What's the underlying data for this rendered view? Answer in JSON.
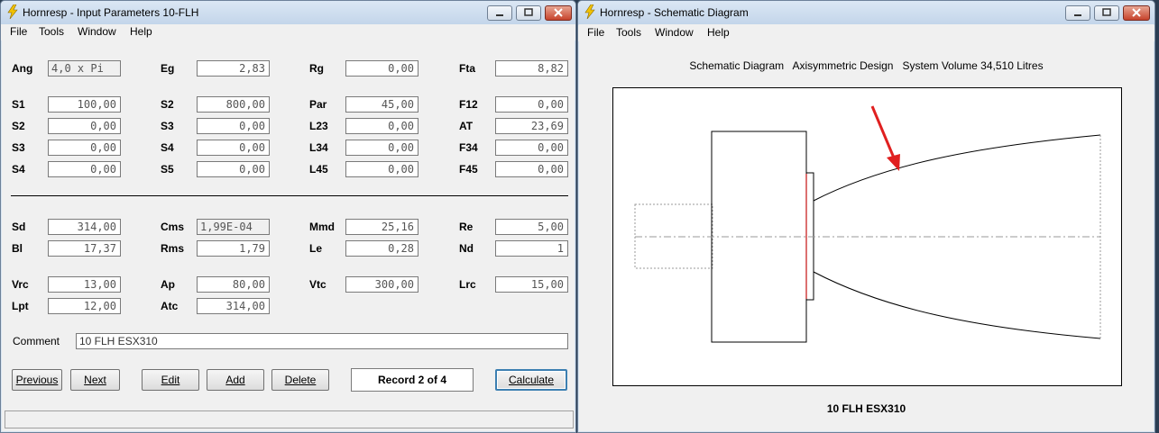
{
  "left_window": {
    "title": "Hornresp - Input Parameters   10-FLH",
    "menu": [
      "File",
      "Tools",
      "Window",
      "Help"
    ],
    "params": [
      {
        "id": "ang",
        "label": "Ang",
        "value": "4,0 x Pi",
        "ro": true,
        "left": true
      },
      {
        "id": "eg",
        "label": "Eg",
        "value": "2,83"
      },
      {
        "id": "rg",
        "label": "Rg",
        "value": "0,00"
      },
      {
        "id": "fta",
        "label": "Fta",
        "value": "8,82"
      },
      {
        "id": "s1",
        "label": "S1",
        "value": "100,00"
      },
      {
        "id": "s2a",
        "label": "S2",
        "value": "800,00"
      },
      {
        "id": "par",
        "label": "Par",
        "value": "45,00"
      },
      {
        "id": "f12",
        "label": "F12",
        "value": "0,00"
      },
      {
        "id": "s2b",
        "label": "S2",
        "value": "0,00"
      },
      {
        "id": "s3a",
        "label": "S3",
        "value": "0,00"
      },
      {
        "id": "l23",
        "label": "L23",
        "value": "0,00"
      },
      {
        "id": "at",
        "label": "AT",
        "value": "23,69"
      },
      {
        "id": "s3b",
        "label": "S3",
        "value": "0,00"
      },
      {
        "id": "s4a",
        "label": "S4",
        "value": "0,00"
      },
      {
        "id": "l34",
        "label": "L34",
        "value": "0,00"
      },
      {
        "id": "f34",
        "label": "F34",
        "value": "0,00"
      },
      {
        "id": "s4b",
        "label": "S4",
        "value": "0,00"
      },
      {
        "id": "s5",
        "label": "S5",
        "value": "0,00"
      },
      {
        "id": "l45",
        "label": "L45",
        "value": "0,00"
      },
      {
        "id": "f45",
        "label": "F45",
        "value": "0,00"
      },
      {
        "id": "sd",
        "label": "Sd",
        "value": "314,00"
      },
      {
        "id": "cms",
        "label": "Cms",
        "value": "1,99E-04",
        "ro": true,
        "left": true
      },
      {
        "id": "mmd",
        "label": "Mmd",
        "value": "25,16"
      },
      {
        "id": "re",
        "label": "Re",
        "value": "5,00"
      },
      {
        "id": "bl",
        "label": "Bl",
        "value": "17,37"
      },
      {
        "id": "rms",
        "label": "Rms",
        "value": "1,79"
      },
      {
        "id": "le",
        "label": "Le",
        "value": "0,28"
      },
      {
        "id": "nd",
        "label": "Nd",
        "value": "1"
      },
      {
        "id": "vrc",
        "label": "Vrc",
        "value": "13,00"
      },
      {
        "id": "ap",
        "label": "Ap",
        "value": "80,00"
      },
      {
        "id": "vtc",
        "label": "Vtc",
        "value": "300,00"
      },
      {
        "id": "lrc",
        "label": "Lrc",
        "value": "15,00"
      },
      {
        "id": "lpt",
        "label": "Lpt",
        "value": "12,00"
      },
      {
        "id": "atc",
        "label": "Atc",
        "value": "314,00"
      }
    ],
    "comment_label": "Comment",
    "comment_value": "10 FLH ESX310",
    "buttons": {
      "previous": "Previous",
      "next": "Next",
      "edit": "Edit",
      "add": "Add",
      "delete": "Delete",
      "calculate": "Calculate"
    },
    "record_text": "Record 2 of 4"
  },
  "right_window": {
    "title": "Hornresp - Schematic Diagram",
    "menu": [
      "File",
      "Tools",
      "Window",
      "Help"
    ],
    "header": "Schematic Diagram   Axisymmetric Design   System Volume 34,510 Litres",
    "footer": "10 FLH ESX310"
  },
  "colors": {
    "annotation_arrow": "#e02020",
    "driver_line": "#d04040",
    "window_bg": "#f0f0f0"
  }
}
